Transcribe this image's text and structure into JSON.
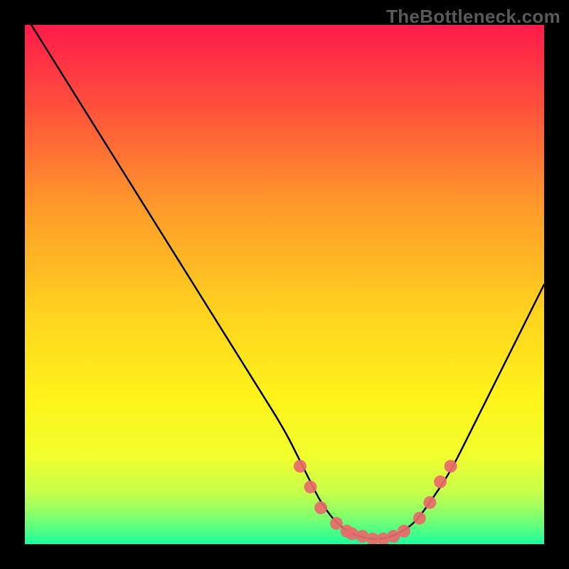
{
  "chart_data": {
    "type": "line",
    "title": "",
    "xlabel": "",
    "ylabel": "",
    "xlim": [
      0,
      100
    ],
    "ylim": [
      0,
      100
    ],
    "series": [
      {
        "name": "curve",
        "x": [
          0,
          5,
          10,
          15,
          20,
          25,
          30,
          35,
          40,
          45,
          50,
          53,
          55,
          57,
          60,
          63,
          66,
          69,
          72,
          75,
          78,
          82,
          86,
          90,
          94,
          98,
          100
        ],
        "y": [
          102,
          94,
          86,
          78,
          70,
          62,
          54,
          46,
          38,
          30,
          22,
          16,
          12,
          8,
          4,
          2,
          1,
          1,
          2,
          4,
          8,
          14,
          22,
          30,
          38,
          46,
          50
        ]
      }
    ],
    "markers": {
      "name": "highlight-dots",
      "x": [
        53,
        55,
        57,
        60,
        62,
        63,
        65,
        67,
        69,
        71,
        73,
        76,
        78,
        80,
        82
      ],
      "y": [
        15,
        11,
        7,
        4,
        2.5,
        2,
        1.5,
        1,
        1,
        1.5,
        2.5,
        5,
        8,
        12,
        15
      ]
    },
    "gradient_stops": [
      {
        "offset": 0.0,
        "color": "#ff1b4b"
      },
      {
        "offset": 0.15,
        "color": "#ff4d3d"
      },
      {
        "offset": 0.35,
        "color": "#ff9a2a"
      },
      {
        "offset": 0.55,
        "color": "#ffd21f"
      },
      {
        "offset": 0.72,
        "color": "#fff41a"
      },
      {
        "offset": 0.83,
        "color": "#f1ff2e"
      },
      {
        "offset": 0.9,
        "color": "#c7ff4a"
      },
      {
        "offset": 0.95,
        "color": "#7dff6e"
      },
      {
        "offset": 1.0,
        "color": "#1bff9d"
      }
    ]
  },
  "watermark": "TheBottleneck.com"
}
